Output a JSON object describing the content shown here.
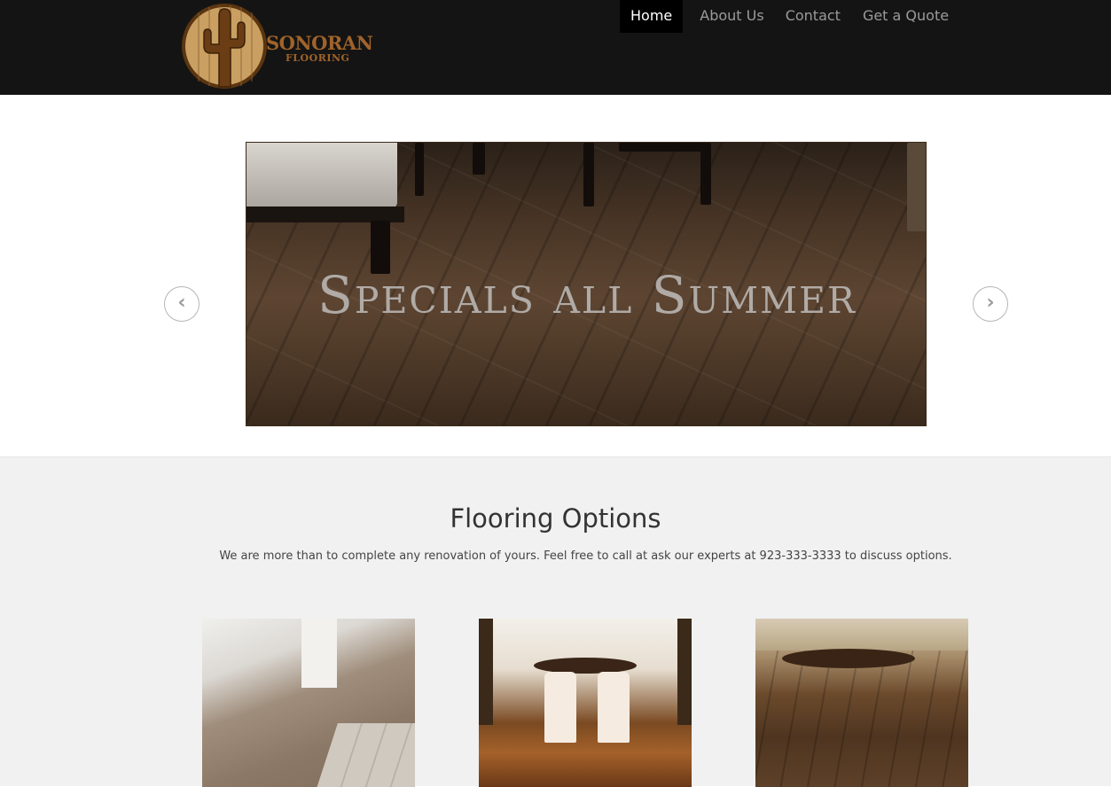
{
  "header": {
    "logo": {
      "name": "SONORAN",
      "sub": "FLOORING"
    },
    "nav": [
      {
        "label": "Home",
        "active": true
      },
      {
        "label": "About Us",
        "active": false
      },
      {
        "label": "Contact",
        "active": false
      },
      {
        "label": "Get a Quote",
        "active": false
      }
    ]
  },
  "carousel": {
    "slide_title": "Specials all Summer",
    "prev_icon": "chevron-left-icon",
    "next_icon": "chevron-right-icon"
  },
  "flooring": {
    "title": "Flooring Options",
    "description": "We are more than to complete any renovation of yours. Feel free to call at ask our experts at 923-333-3333 to discuss options."
  },
  "colors": {
    "header_bg": "#141414",
    "brand": "#a0632a",
    "section_bg": "#f1f1f1"
  }
}
